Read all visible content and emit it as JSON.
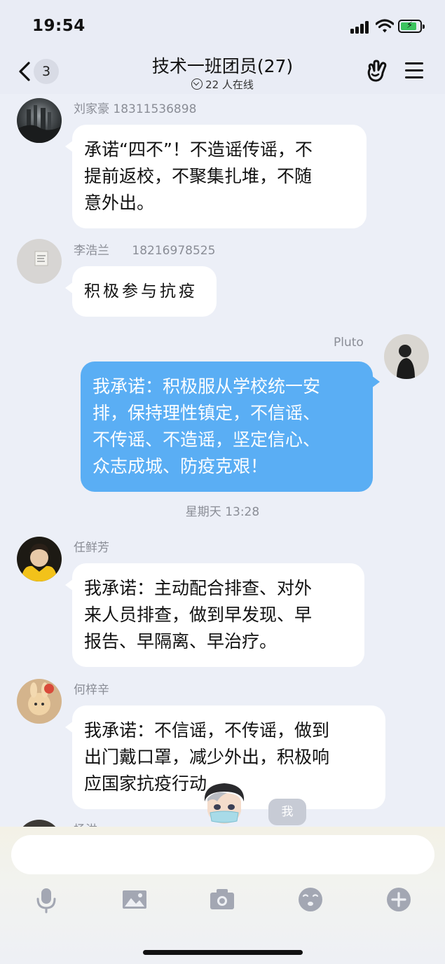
{
  "status_bar": {
    "time": "19:54"
  },
  "header": {
    "back_count": "3",
    "title": "技术一班团员(27)",
    "online_text": "22 人在线"
  },
  "messages": [
    {
      "sender": "刘家豪 18311536898",
      "lines": [
        "承诺“四不”！不造谣传谣，不",
        "提前返校，不聚集扎堆，不随",
        "意外出。"
      ]
    },
    {
      "sender": "李浩兰      18216978525",
      "lines": [
        "积极参与抗疫"
      ]
    },
    {
      "sender": "Pluto",
      "lines": [
        "我承诺：积极服从学校统一安",
        "排，保持理性镇定，不信谣、",
        "不传谣、不造谣，坚定信心、",
        "众志成城、防疫克艰！"
      ]
    },
    {
      "sender": "任鲜芳",
      "lines": [
        "我承诺：主动配合排查、对外",
        "来人员排查，做到早发现、早",
        "报告、早隔离、早治疗。"
      ]
    },
    {
      "sender": "何梓辛",
      "lines": [
        "我承诺：不信谣，不传谣，做到",
        "出门戴口罩，减少外出，积极响",
        "应国家抗疫行动"
      ]
    },
    {
      "sender": "杨洪",
      "lines": []
    }
  ],
  "time_divider": "星期天 13:28",
  "sticker_tag": "我",
  "input": {
    "value": ""
  }
}
